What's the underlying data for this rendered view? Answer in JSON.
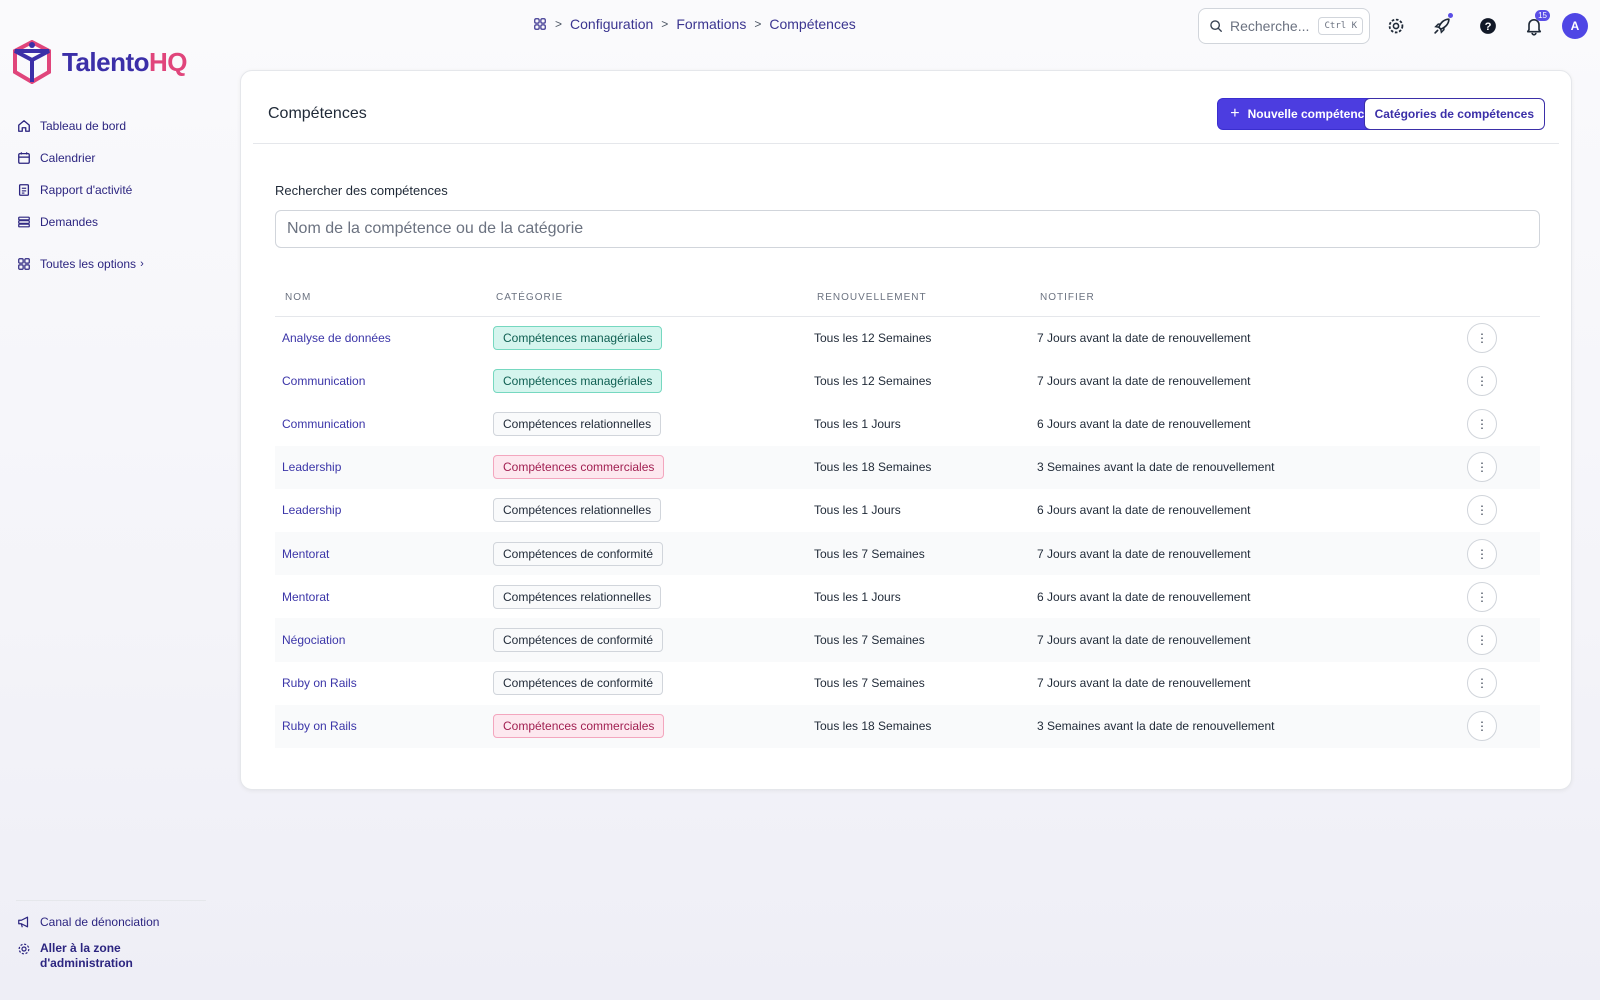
{
  "brand": {
    "name_part1": "Talento",
    "name_part2": "HQ",
    "colors": {
      "primary": "#3b2fa8",
      "accent": "#e0457b"
    }
  },
  "sidebar": {
    "items": [
      {
        "label": "Tableau de bord",
        "icon": "home-icon"
      },
      {
        "label": "Calendrier",
        "icon": "calendar-icon"
      },
      {
        "label": "Rapport d'activité",
        "icon": "report-icon"
      },
      {
        "label": "Demandes",
        "icon": "stack-icon"
      }
    ],
    "all_options": {
      "label": "Toutes les options",
      "icon": "grid-icon"
    },
    "bottom": [
      {
        "label": "Canal de dénonciation",
        "icon": "megaphone-icon"
      },
      {
        "label_line1": "Aller à la zone",
        "label_line2": "d'administration",
        "icon": "gear-icon"
      }
    ]
  },
  "breadcrumb": {
    "items": [
      "Configuration",
      "Formations",
      "Compétences"
    ]
  },
  "topbar": {
    "search_label": "Recherche...",
    "search_kbd": "Ctrl K",
    "notification_count": "15",
    "avatar_initial": "A"
  },
  "page": {
    "title": "Compétences",
    "new_button": "Nouvelle compétence",
    "categories_button": "Catégories de compétences",
    "search_label": "Rechercher des compétences",
    "search_placeholder": "Nom de la compétence ou de la catégorie"
  },
  "table": {
    "columns": [
      "NOM",
      "CATÉGORIE",
      "RENOUVELLEMENT",
      "NOTIFIER"
    ],
    "rows": [
      {
        "name": "Analyse de données",
        "category": "Compétences managériales",
        "category_style": "green",
        "renewal": "Tous les 12 Semaines",
        "notify": "7 Jours avant la date de renouvellement"
      },
      {
        "name": "Communication",
        "category": "Compétences managériales",
        "category_style": "green",
        "renewal": "Tous les 12 Semaines",
        "notify": "7 Jours avant la date de renouvellement"
      },
      {
        "name": "Communication",
        "category": "Compétences relationnelles",
        "category_style": "gray",
        "renewal": "Tous les 1 Jours",
        "notify": "6 Jours avant la date de renouvellement"
      },
      {
        "name": "Leadership",
        "category": "Compétences commerciales",
        "category_style": "pink",
        "renewal": "Tous les 18 Semaines",
        "notify": "3 Semaines avant la date de renouvellement"
      },
      {
        "name": "Leadership",
        "category": "Compétences relationnelles",
        "category_style": "gray",
        "renewal": "Tous les 1 Jours",
        "notify": "6 Jours avant la date de renouvellement"
      },
      {
        "name": "Mentorat",
        "category": "Compétences de conformité",
        "category_style": "gray",
        "renewal": "Tous les 7 Semaines",
        "notify": "7 Jours avant la date de renouvellement"
      },
      {
        "name": "Mentorat",
        "category": "Compétences relationnelles",
        "category_style": "gray",
        "renewal": "Tous les 1 Jours",
        "notify": "6 Jours avant la date de renouvellement"
      },
      {
        "name": "Négociation",
        "category": "Compétences de conformité",
        "category_style": "gray",
        "renewal": "Tous les 7 Semaines",
        "notify": "7 Jours avant la date de renouvellement"
      },
      {
        "name": "Ruby on Rails",
        "category": "Compétences de conformité",
        "category_style": "gray",
        "renewal": "Tous les 7 Semaines",
        "notify": "7 Jours avant la date de renouvellement"
      },
      {
        "name": "Ruby on Rails",
        "category": "Compétences commerciales",
        "category_style": "pink",
        "renewal": "Tous les 18 Semaines",
        "notify": "3 Semaines avant la date de renouvellement"
      }
    ]
  }
}
